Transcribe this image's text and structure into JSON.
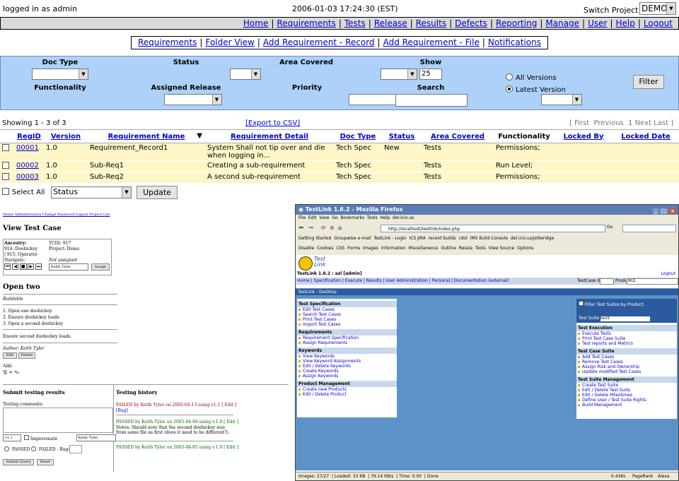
{
  "top": {
    "user": "logged in as admin",
    "datetime": "2006-01-03 17:24:30 (EST)",
    "switch_label": "Switch Project",
    "project": "DEMO"
  },
  "nav1": [
    "Home",
    "Requirements",
    "Tests",
    "Release",
    "Results",
    "Defects",
    "Reporting",
    "Manage",
    "User",
    "Help",
    "Logout"
  ],
  "nav2": [
    "Requirements",
    "Folder View",
    "Add Requirement - Record",
    "Add Requirement - File",
    "Notifications"
  ],
  "filters": {
    "doc_type": "Doc Type",
    "status": "Status",
    "area_covered": "Area Covered",
    "show": "Show",
    "show_value": "25",
    "functionality": "Functionality",
    "assigned_release": "Assigned Release",
    "priority": "Priority",
    "search": "Search",
    "all_versions": "All Versions",
    "latest_version": "Latest Version",
    "filter_button": "Filter"
  },
  "info": {
    "showing": "Showing 1 - 3 of 3",
    "export": "[Export to CSV]",
    "pager_open": "[",
    "first": "First",
    "previous": "Previous",
    "page": "1",
    "next": "Next",
    "last": "Last",
    "pager_close": "]"
  },
  "table": {
    "headers": [
      "RegID",
      "Version",
      "Requirement Name",
      "Requirement Detail",
      "Doc Type",
      "Status",
      "Area Covered",
      "Functionality",
      "Locked By",
      "Locked Date"
    ],
    "rows": [
      {
        "id": "00001",
        "version": "1.0",
        "name": "Requirement_Record1",
        "detail": "System Shall not tip over and die when logging in...",
        "doc_type": "Tech Spec",
        "status": "New",
        "area": "Tests",
        "functionality": "Permissions;",
        "locked_by": "",
        "locked_date": ""
      },
      {
        "id": "00002",
        "version": "1.0",
        "name": "Sub-Req1",
        "detail": "Creating a sub-requirement",
        "doc_type": "Tech Spec",
        "status": "",
        "area": "Tests",
        "functionality": "Run Level;",
        "locked_by": "",
        "locked_date": ""
      },
      {
        "id": "00003",
        "version": "1.0",
        "name": "Sub-Req2",
        "detail": "A second sub-requirement",
        "doc_type": "Tech Spec",
        "status": "",
        "area": "Tests",
        "functionality": "Permissions;",
        "locked_by": "",
        "locked_date": ""
      }
    ]
  },
  "bulk": {
    "select_all": "Select All",
    "status_option": "Status",
    "update_button": "Update"
  },
  "left_mock": {
    "toplinks": [
      "Home",
      "Administration",
      "Change Password",
      "Logout",
      "Project List"
    ],
    "view_test_case": "View Test Case",
    "ancestry_label": "Ancestry:",
    "ancestry_1": "914: Doohickey",
    "ancestry_2": "| 915: Operator",
    "tcid": "TCID: 917",
    "project": "Project: Demo",
    "navigate": "Navigate:",
    "not_assigned": "Not assigned",
    "assignee": "Keith Tyler",
    "assign_button": "Assign",
    "open_two": "Open two",
    "buildable": "Buildable",
    "steps": [
      "1. Open one doohickey",
      "2. Ensure doohickey loads",
      "3. Open a second doohickey"
    ],
    "expected": "Ensure second doohickey loads.",
    "author": "Author: Keith Tyler",
    "edit": "Edit",
    "delete": "Delete",
    "add": "Add:",
    "submit_title": "Submit testing results",
    "testing_comments": "Testing comments:",
    "version_sel": "v1.1",
    "impersonate": "Impersonate",
    "imp_user": "Keith Tyler",
    "passed": "PASSED",
    "failed": "FAILED - Bug#:",
    "submit_query": "Submit Query",
    "reset": "Reset",
    "history_title": "Testing history",
    "h1": "FAILED by Keith Tyler on 2005-04-13 using v1.1 [ Edit ]",
    "h1_bug": "[Bug]",
    "h2": "PASSED by Keith Tyler on 2005-04-06 using v.1.0 [ Edit ]",
    "h2_notes": "Notes: Should note that the second doohickey was from same file as first (does it need to be different?).",
    "h3": "PASSED by Keith Tyler on 2005-04-05 using v.1.0 [ Edit ]"
  },
  "firefox": {
    "title": "TestLink 1.6.2 - Mozilla Firefox",
    "menu": [
      "File",
      "Edit",
      "View",
      "Go",
      "Bookmarks",
      "Tools",
      "Help",
      "del.icio.us"
    ],
    "url": "http://localhost/testlink/index.php",
    "go": "Go",
    "bookmarks": [
      "Getting Started",
      "Groupwise e-mail",
      "TestLink - Login",
      "ICS JIRA",
      "recent builds",
      "cdol",
      "IMS Build Console",
      "del.icio.us/jetteridge"
    ],
    "devbar": [
      "Disable",
      "Cookies",
      "CSS",
      "Forms",
      "Images",
      "Information",
      "Miscellaneous",
      "Outline",
      "Resize",
      "Tools",
      "View Source",
      "Options"
    ],
    "logo_text": "Test Link",
    "app_title": "TestLink 1.6.2 : azl [admin]",
    "logout": "Logout",
    "appnav": "Home | Specification | Execute | Results | User Administration | Personal | Documentation (external)",
    "testcase_id": "TestCase ID:",
    "product": "Product",
    "product_value": "MLS",
    "desktop": "TestLink - Desktop",
    "left_sections": [
      {
        "title": "Test Specification",
        "items": [
          "Edit Test Cases",
          "Search Test Cases",
          "Print Test Cases",
          "Import Test Cases"
        ]
      },
      {
        "title": "Requirements",
        "items": [
          "Requirement Specification",
          "Assign Requirements"
        ]
      },
      {
        "title": "Keywords",
        "items": [
          "View Keywords",
          "View Keyword Assignments",
          "Edit / Delete Keywords",
          "Create Keywords",
          "Assign Keywords"
        ]
      },
      {
        "title": "Product Management",
        "items": [
          "Create new Products",
          "Edit / Delete Product"
        ]
      }
    ],
    "filter_suites": "Filter Test Suites by Product",
    "test_suite": "Test Suite",
    "test_suite_value": "test3",
    "right_sections": [
      {
        "title": "Test Execution",
        "items": [
          "Execute Tests",
          "Print Test Case Suite",
          "Test reports and Metrics"
        ]
      },
      {
        "title": "Test Case Suite",
        "items": [
          "Add Test Cases",
          "Remove Test Cases",
          "Assign Risk and Ownership",
          "Update modified Test Cases"
        ]
      },
      {
        "title": "Test Suite Management",
        "items": [
          "Create Test Suite",
          "Edit / Delete Test Suite",
          "Edit / Delete Milestones",
          "Define User / Test Suite Rights",
          "Build Management"
        ]
      }
    ],
    "status": [
      "Images: 27/27",
      "Loaded: 33 KB",
      "79.14 KB/s",
      "Time: 0.00",
      "Done",
      "0.436s",
      "PageRank",
      "Alexa"
    ]
  }
}
